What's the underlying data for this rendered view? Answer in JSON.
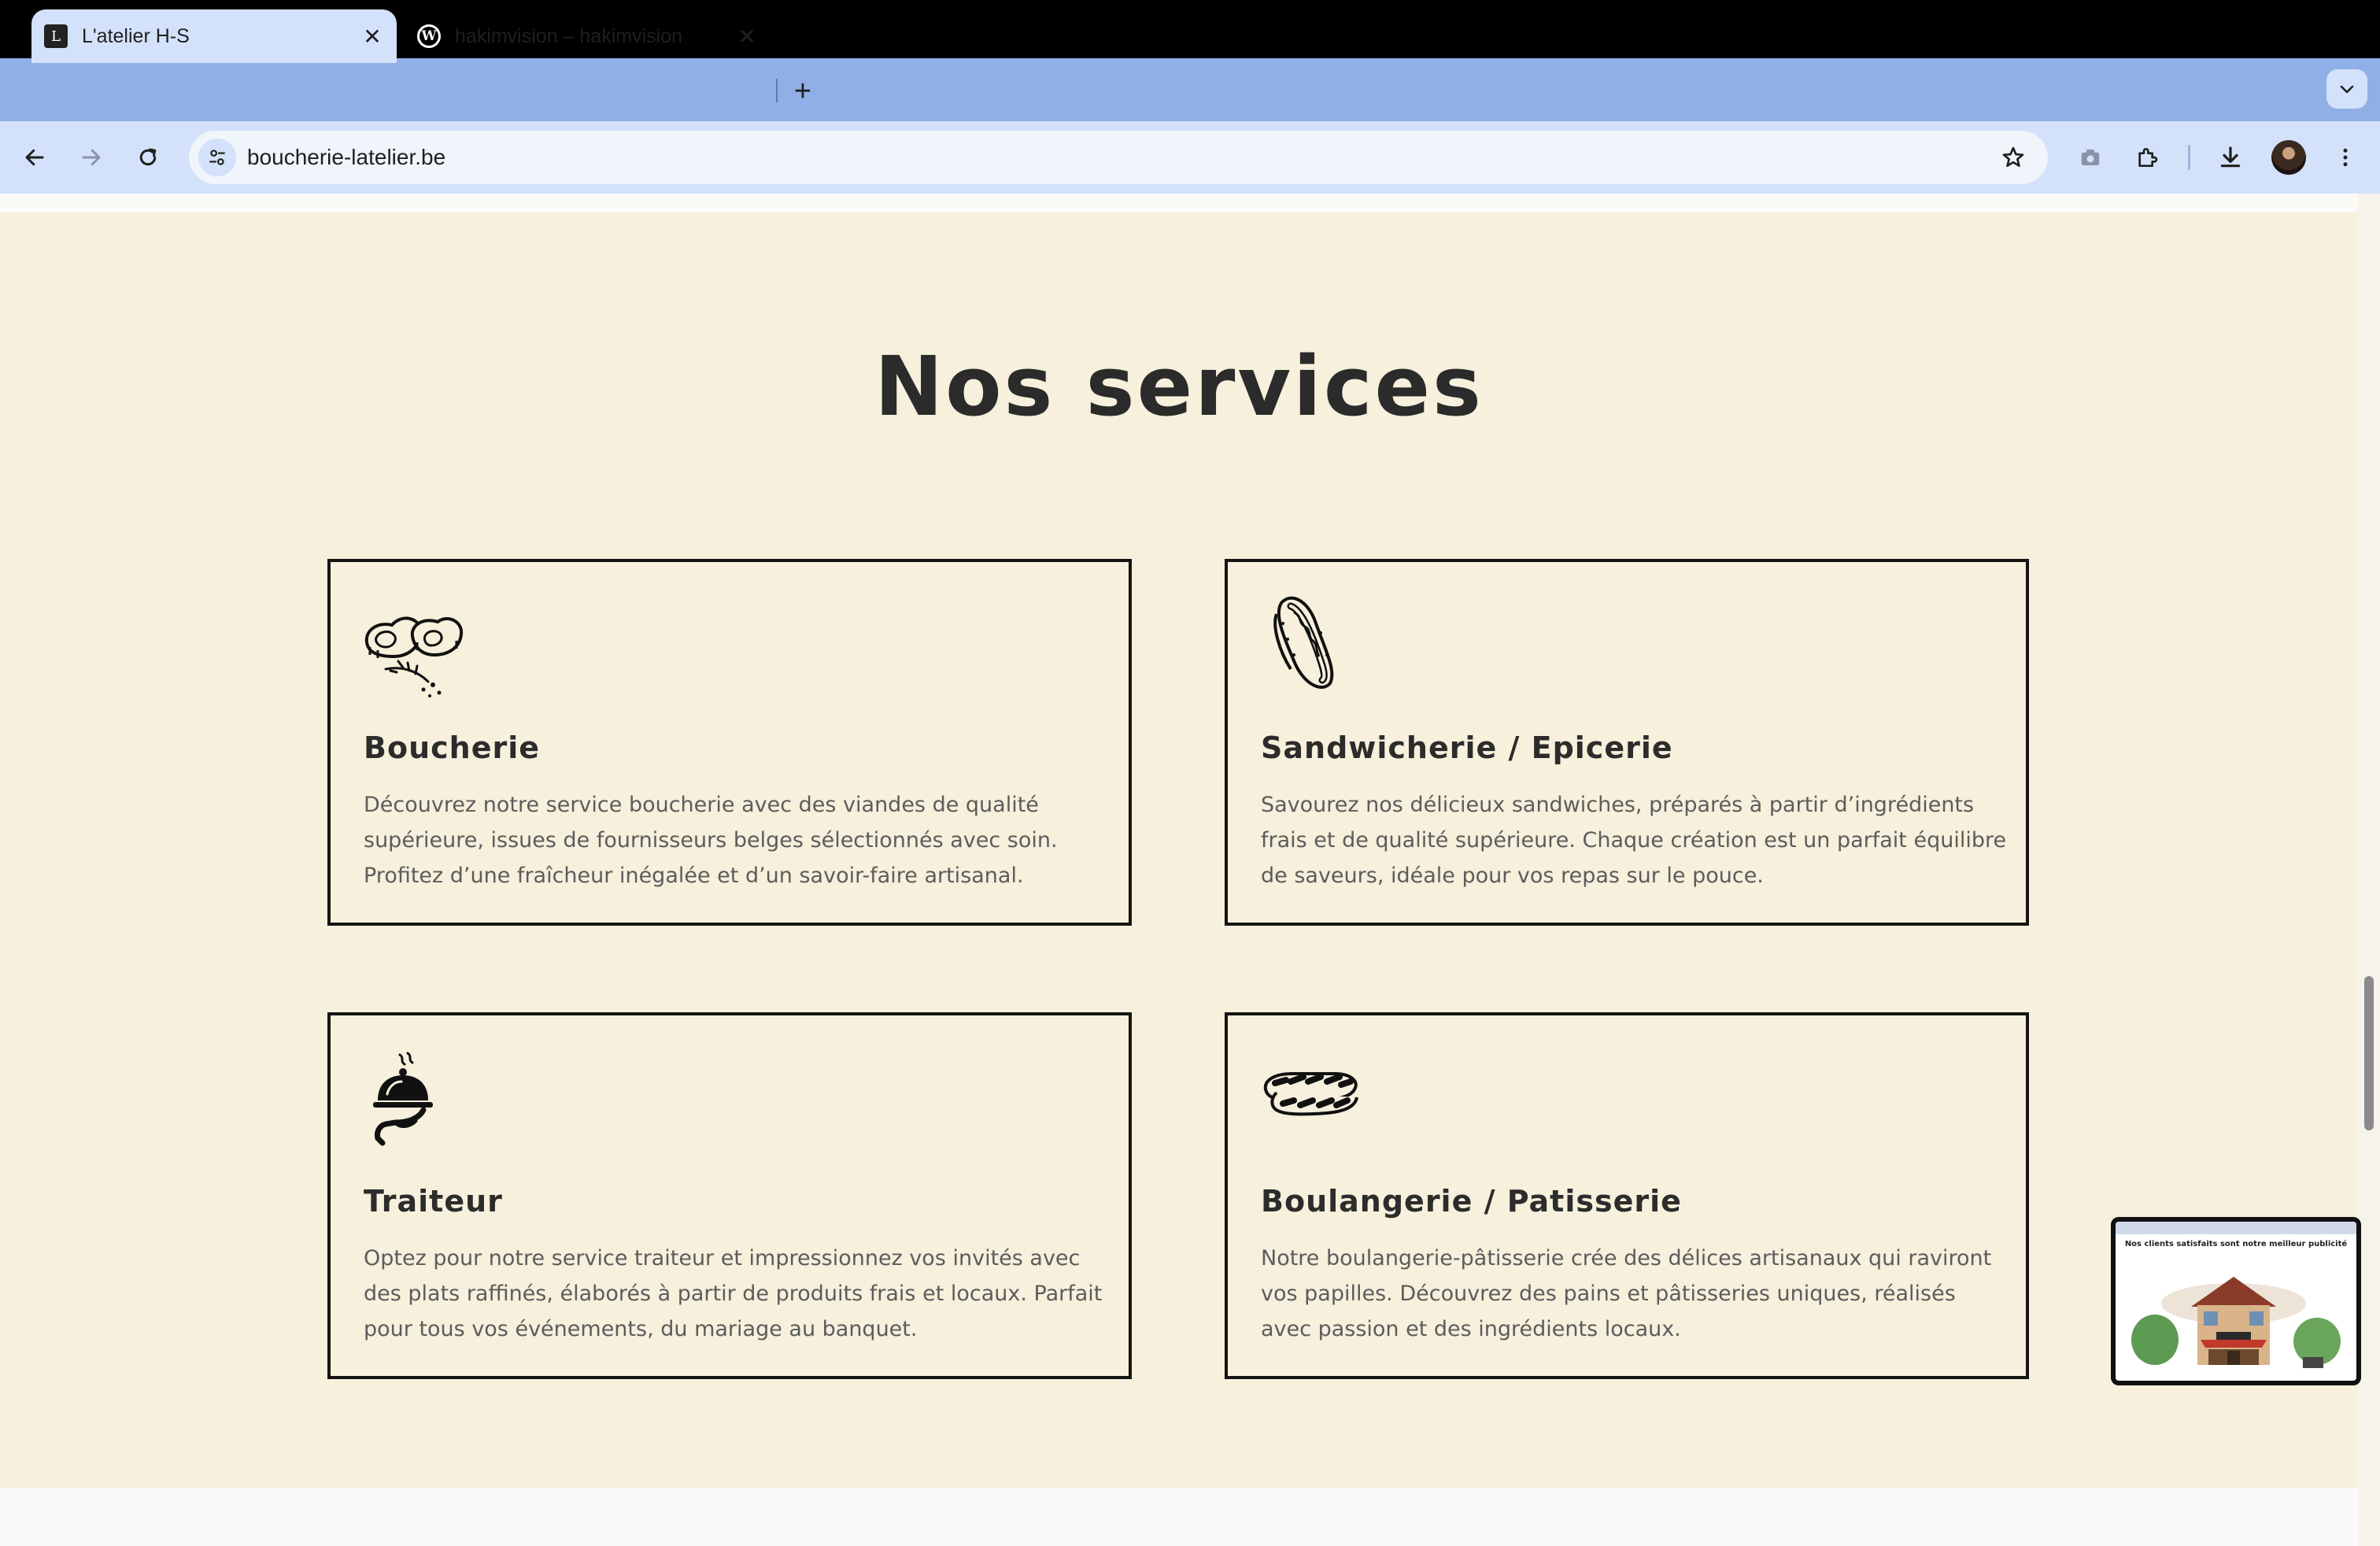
{
  "browser": {
    "tabs": [
      {
        "title": "L'atelier H-S",
        "favicon": "atelier-logo-icon",
        "active": true
      },
      {
        "title": "hakimvision – hakimvision",
        "favicon": "wordpress-icon",
        "active": false
      }
    ],
    "url": "boucherie-latelier.be"
  },
  "page": {
    "section_title": "Nos services",
    "services": [
      {
        "icon": "steak-icon",
        "title": "Boucherie",
        "text": "Découvrez notre service boucherie avec des viandes de qualité supérieure, issues de fournisseurs belges sélectionnés avec soin. Profitez d’une fraîcheur inégalée et d’un savoir-faire artisanal."
      },
      {
        "icon": "hotdog-icon",
        "title": "Sandwicherie / Epicerie",
        "text": "Savourez nos délicieux sandwiches, préparés à partir d’ingrédients frais et de qualité supérieure. Chaque création est un parfait équilibre de saveurs, idéale pour vos repas sur le pouce."
      },
      {
        "icon": "cloche-icon",
        "title": "Traiteur",
        "text": "Optez pour notre service traiteur et impressionnez vos invités avec des plats raffinés, élaborés à partir de produits frais et locaux. Parfait pour tous vos événements, du mariage au banquet."
      },
      {
        "icon": "bread-icon",
        "title": "Boulangerie / Patisserie",
        "text": "Notre boulangerie-pâtisserie crée des délices artisanaux qui raviront vos papilles. Découvrez des pains et pâtisseries uniques, réalisés avec passion et des ingrédients locaux."
      }
    ],
    "video_thumbnail_text": "Nos clients satisfaits sont notre meilleur publicité"
  }
}
